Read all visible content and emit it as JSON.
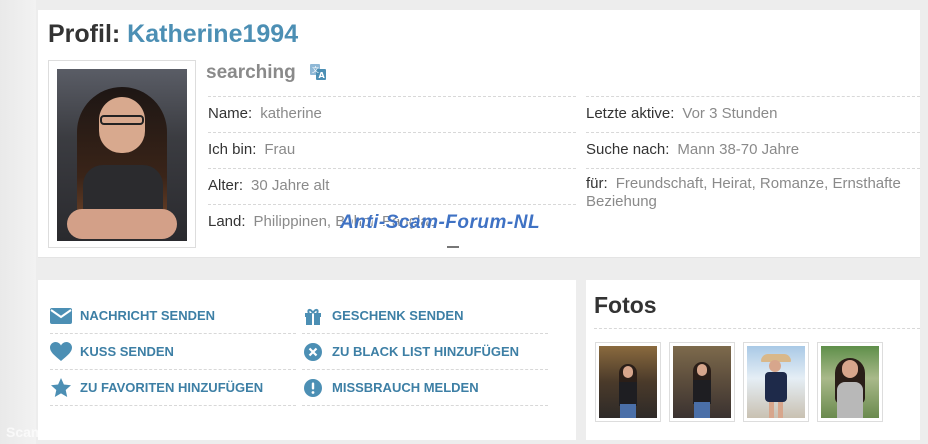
{
  "profile": {
    "title_prefix": "Profil:",
    "username": "Katherine1994",
    "status": "searching",
    "fields": [
      {
        "label": "Name:",
        "value": "katherine"
      },
      {
        "label": "Ich bin:",
        "value": "Frau"
      },
      {
        "label": "Alter:",
        "value": "30 Jahre alt"
      },
      {
        "label": "Land:",
        "value": "Philippinen, Bohol, Panglao"
      }
    ],
    "fields_right": [
      {
        "label": "Letzte aktive:",
        "value": "Vor 3 Stunden"
      },
      {
        "label": "Suche nach:",
        "value": "Mann 38-70 Jahre"
      },
      {
        "label": "für:",
        "value": "Freundschaft, Heirat, Romanze, Ernsthafte Beziehung"
      }
    ]
  },
  "watermark": "Anti-Scam-Forum-NL",
  "actions": [
    {
      "label": "NACHRICHT SENDEN",
      "icon": "envelope-icon"
    },
    {
      "label": "GESCHENK SENDEN",
      "icon": "gift-icon"
    },
    {
      "label": "KUSS SENDEN",
      "icon": "heart-icon"
    },
    {
      "label": "ZU BLACK LIST HINZUFÜGEN",
      "icon": "block-icon"
    },
    {
      "label": "ZU FAVORITEN HINZUFÜGEN",
      "icon": "star-icon"
    },
    {
      "label": "MISSBRAUCH MELDEN",
      "icon": "warning-icon"
    }
  ],
  "photos": {
    "title": "Fotos",
    "count": 4
  },
  "corner_watermark": "ScamBusters",
  "colors": {
    "accent": "#4c8fb4",
    "action_text": "#3d7fa5",
    "label": "#333333",
    "value": "#8a8a8a"
  }
}
